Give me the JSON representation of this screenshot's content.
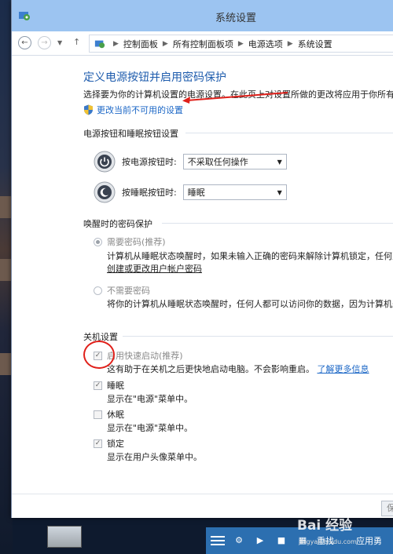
{
  "window": {
    "title": "系统设置"
  },
  "breadcrumb": [
    "控制面板",
    "所有控制面板项",
    "电源选项",
    "系统设置"
  ],
  "page": {
    "title": "定义电源按钮并启用密码保护",
    "intro": "选择要为你的计算机设置的电源设置。在此页上对设置所做的更改将应用于你所有的",
    "unavailable_link": "更改当前不可用的设置"
  },
  "power_section": {
    "heading": "电源按钮和睡眠按钮设置",
    "power_button_label": "按电源按钮时:",
    "power_button_value": "不采取任何操作",
    "sleep_button_label": "按睡眠按钮时:",
    "sleep_button_value": "睡眠"
  },
  "wake_section": {
    "heading": "唤醒时的密码保护",
    "require_label": "需要密码(推荐)",
    "require_desc": "计算机从睡眠状态唤醒时，如果未输入正确的密码来解除计算机锁定，任何人",
    "create_link": "创建或更改用户帐户密码",
    "norequire_label": "不需要密码",
    "norequire_desc": "将你的计算机从睡眠状态唤醒时，任何人都可以访问你的数据，因为计算机未"
  },
  "shutdown_section": {
    "heading": "关机设置",
    "fast_label": "启用快速启动(推荐)",
    "fast_desc": "这有助于在关机之后更快地启动电脑。不会影响重启。",
    "learn_more": "了解更多信息",
    "sleep_label": "睡眠",
    "sleep_desc": "显示在\"电源\"菜单中。",
    "hibernate_label": "休眠",
    "hibernate_desc": "显示在\"电源\"菜单中。",
    "lock_label": "锁定",
    "lock_desc": "显示在用户头像菜单中。"
  },
  "footer": {
    "save_label": "保"
  },
  "taskbar": {
    "text_a": "重找",
    "text_b": "应用勇"
  },
  "watermark": {
    "main": "Bai 经验",
    "sub": "jingyan.baidu.com"
  },
  "colors": {
    "accent": "#1e5cad",
    "title_bar": "#9cc4f1",
    "annotation": "#e0201a"
  }
}
